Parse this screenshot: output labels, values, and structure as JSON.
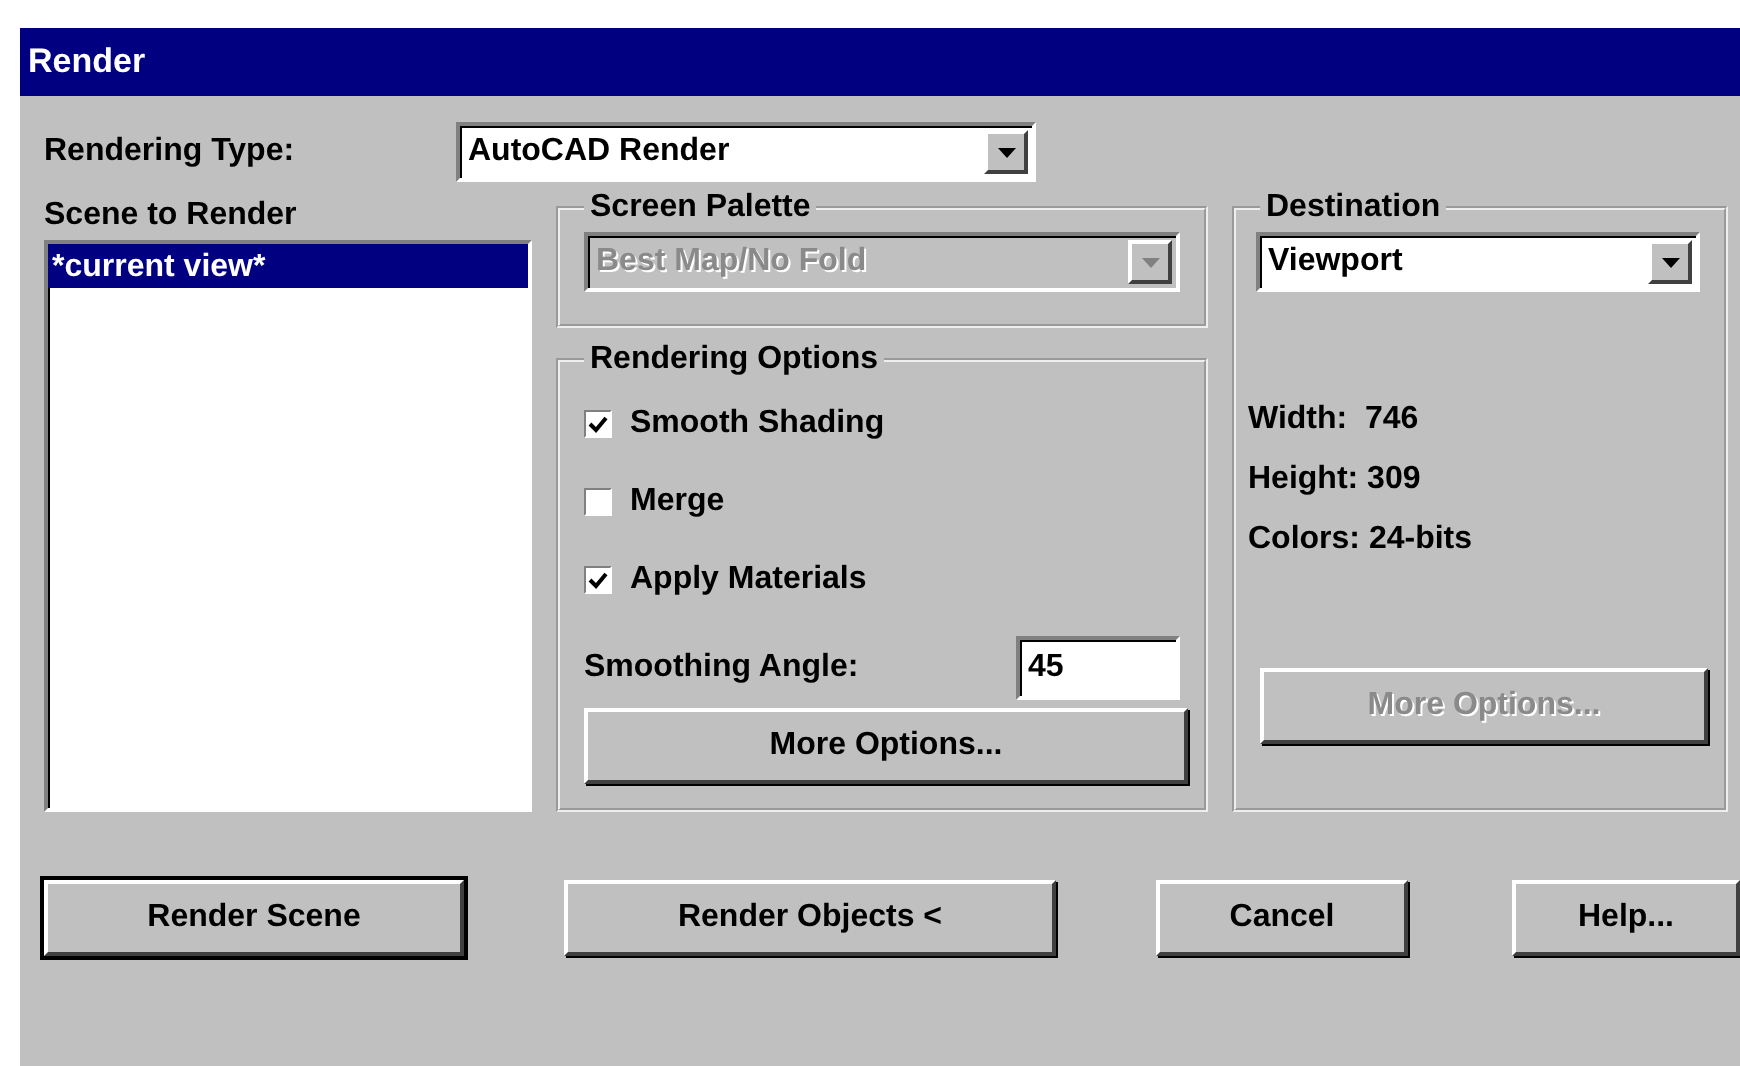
{
  "window": {
    "title": "Render"
  },
  "rendering_type": {
    "label": "Rendering Type:",
    "value": "AutoCAD Render"
  },
  "scene_list": {
    "label": "Scene to Render",
    "items": [
      {
        "text": "*current view*",
        "selected": true
      }
    ]
  },
  "screen_palette": {
    "title": "Screen Palette",
    "value": "Best Map/No Fold",
    "disabled": true
  },
  "rendering_options": {
    "title": "Rendering Options",
    "checkboxes": [
      {
        "label": "Smooth Shading",
        "checked": true
      },
      {
        "label": "Merge",
        "checked": false
      },
      {
        "label": "Apply Materials",
        "checked": true
      }
    ],
    "smoothing_angle": {
      "label": "Smoothing Angle:",
      "value": "45"
    },
    "more_options": {
      "label": "More Options...",
      "disabled": false
    }
  },
  "destination": {
    "title": "Destination",
    "value": "Viewport",
    "info": [
      "Width:  746",
      "Height: 309",
      "Colors: 24-bits"
    ],
    "more_options": {
      "label": "More Options...",
      "disabled": true
    }
  },
  "buttons": [
    {
      "label": "Render Scene",
      "default": true
    },
    {
      "label": "Render Objects <",
      "default": false
    },
    {
      "label": "Cancel",
      "default": false
    },
    {
      "label": "Help...",
      "default": false
    }
  ]
}
